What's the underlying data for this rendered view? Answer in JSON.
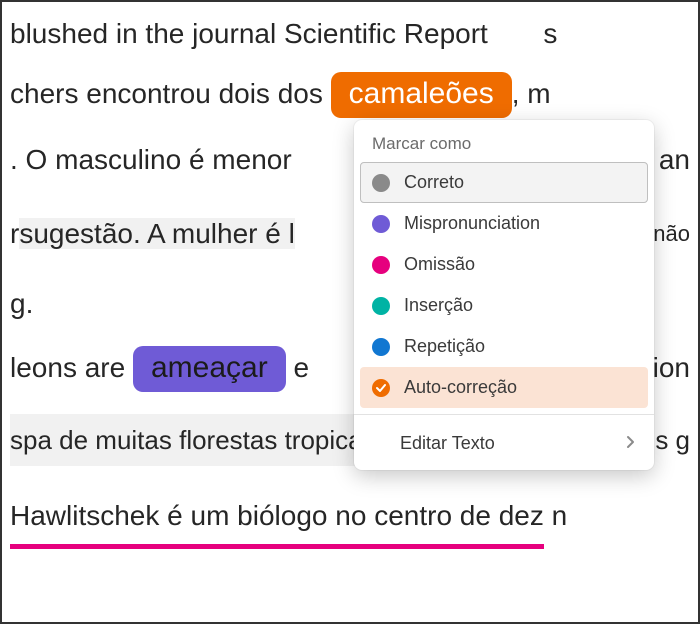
{
  "lines": {
    "l1a": "blushed in the journal Scientific Report",
    "l1b": "s",
    "l2a": "chers encontrou dois dos ",
    "l2_chip": "camaleões",
    "l2b": ", m",
    "l3a": ". O masculino é menor",
    "l3b": "an",
    "l4a": "r",
    "l4_grey": "sugestão. A mulher é l",
    "l4b": "não",
    "l5": "g.",
    "l6a": "leons are ",
    "l6_chip": "ameaçar",
    "l6b": " e",
    "l6c": "ion",
    "l7_grey": "spa de muitas florestas tropical",
    "l7b": "s g",
    "l8a": "Hawlitschek é um biólogo no centro de dez ",
    "l8b": "n"
  },
  "menu": {
    "header": "Marcar como",
    "items": [
      {
        "label": "Correto"
      },
      {
        "label": "Mispronunciation"
      },
      {
        "label": "Omissão"
      },
      {
        "label": "Inserção"
      },
      {
        "label": "Repetição"
      },
      {
        "label": "Auto-correção"
      }
    ],
    "edit": "Editar Texto"
  }
}
